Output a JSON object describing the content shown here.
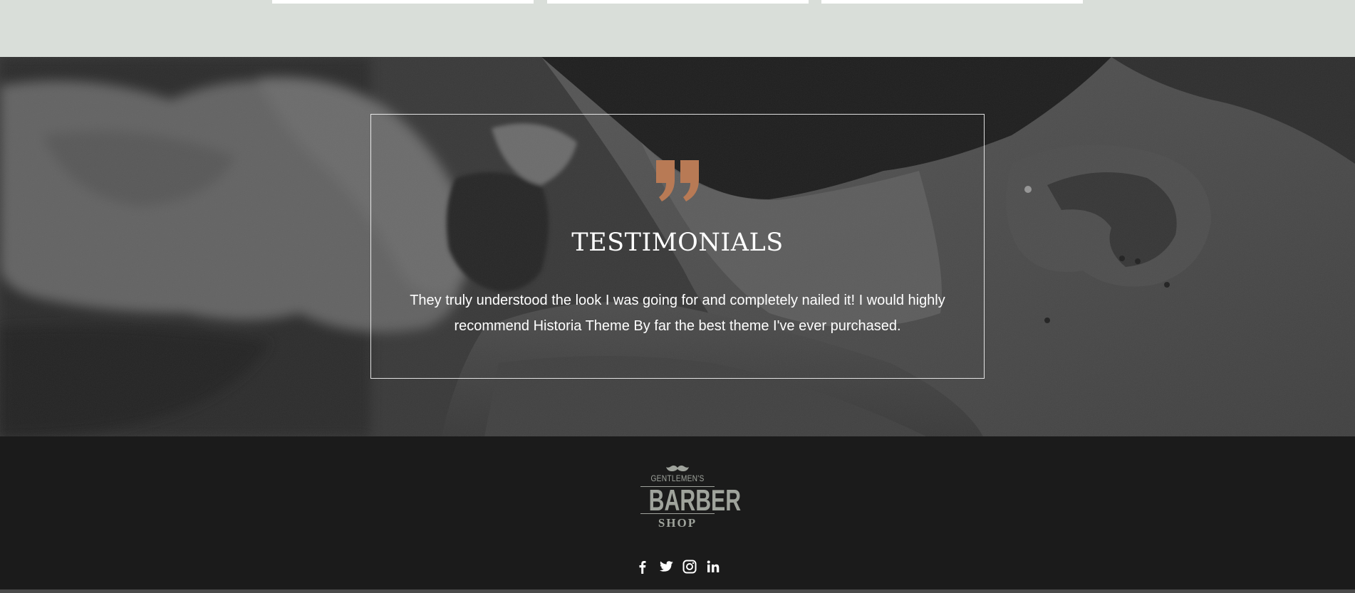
{
  "top_section": {
    "cards": [
      "card-1",
      "card-2",
      "card-3"
    ]
  },
  "testimonials": {
    "icon": "quote-icon",
    "title": "TESTIMONIALS",
    "text": "They truly understood the look I was going for and completely nailed it! I would highly recommend Historia Theme By far the best theme I've ever purchased.",
    "accent_color": "#b87a55"
  },
  "footer": {
    "logo": {
      "line1": "GENTLEMEN'S",
      "line2": "BARBER",
      "line3": "SHOP",
      "icon": "mustache-icon"
    },
    "social": [
      {
        "name": "facebook",
        "icon": "facebook-icon"
      },
      {
        "name": "twitter",
        "icon": "twitter-icon"
      },
      {
        "name": "instagram",
        "icon": "instagram-icon"
      },
      {
        "name": "linkedin",
        "icon": "linkedin-icon"
      }
    ]
  },
  "colors": {
    "top_strip": "#d9ded9",
    "footer_bg": "#1b1b1b",
    "logo": "#9fa39c",
    "text": "#ffffff"
  }
}
